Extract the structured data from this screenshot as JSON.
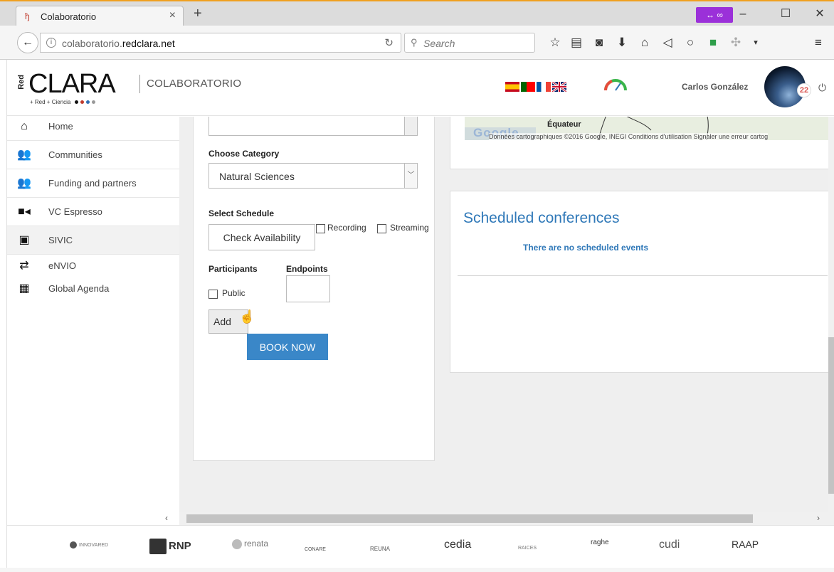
{
  "browser": {
    "tab_title": "Colaboratorio",
    "url_host": "colaboratorio.",
    "url_domain": "redclara.net",
    "search_placeholder": "Search"
  },
  "header": {
    "logo_red": "Red",
    "logo_text": "CLARA",
    "logo_sub": "+ Red  + Ciencia",
    "title": "COLABORATORIO",
    "user_name": "Carlos González",
    "notification_count": "22"
  },
  "sidebar": {
    "items": [
      {
        "label": "Home",
        "icon": "home-icon"
      },
      {
        "label": "Communities",
        "icon": "communities-icon"
      },
      {
        "label": "Funding and partners",
        "icon": "partners-icon"
      },
      {
        "label": "VC Espresso",
        "icon": "video-camera-icon"
      },
      {
        "label": "SIVIC",
        "icon": "sivic-icon"
      },
      {
        "label": "eNVIO",
        "icon": "transfer-icon"
      },
      {
        "label": "Global Agenda",
        "icon": "calendar-icon"
      }
    ]
  },
  "form": {
    "category_label": "Choose Category",
    "category_value": "Natural Sciences",
    "schedule_label": "Select Schedule",
    "check_availability": "Check Availability",
    "recording": "Recording",
    "streaming": "Streaming",
    "participants_label": "Participants",
    "endpoints_label": "Endpoints",
    "public_label": "Public",
    "add_label": "Add",
    "book_now": "BOOK NOW"
  },
  "map": {
    "place": "Équateur",
    "google": "Google",
    "attribution": "Données cartographiques ©2016 Google, INEGI   Conditions d'utilisation   Signaler une erreur cartog"
  },
  "scheduled": {
    "title": "Scheduled conferences",
    "empty": "There are no scheduled events"
  },
  "footer": {
    "partners": [
      "INNOVARED",
      "RNP",
      "renata",
      "CONARE",
      "REUNA",
      "cedia",
      "RAICES",
      "raghe",
      "cudi",
      "RAAP"
    ]
  },
  "colors": {
    "accent": "#3a87c8",
    "link": "#2f78b8",
    "mask_badge": "#9b30d9"
  }
}
